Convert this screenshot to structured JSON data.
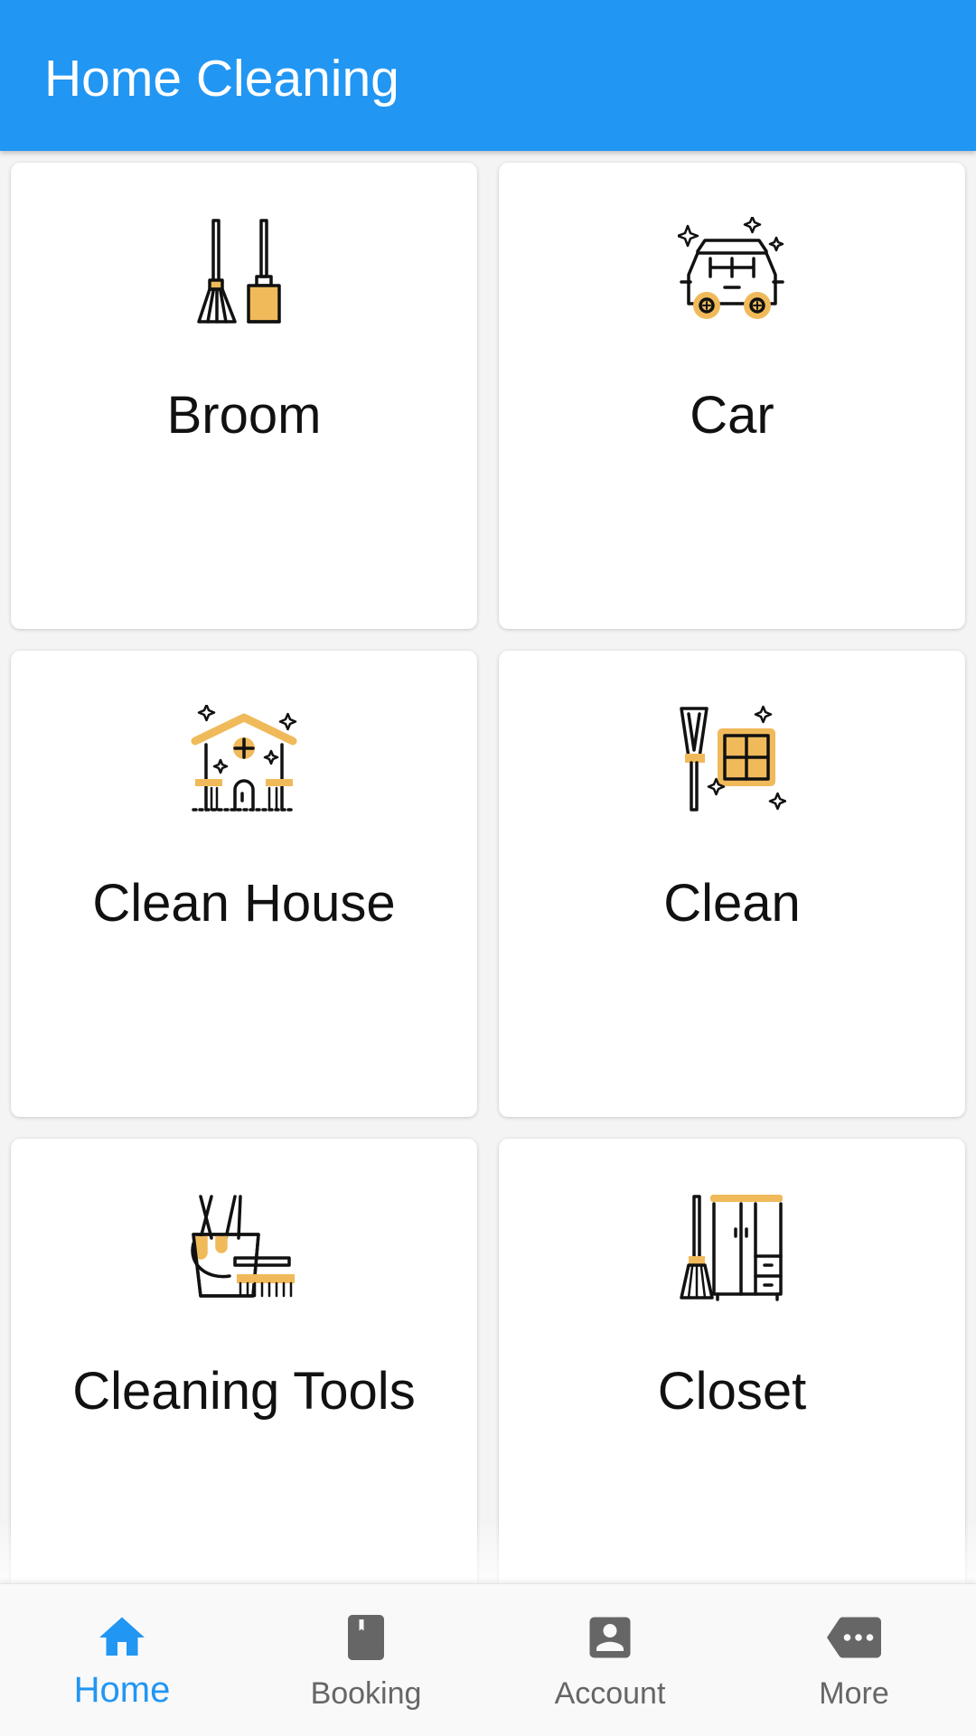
{
  "app_bar": {
    "title": "Home Cleaning"
  },
  "categories": [
    {
      "label": "Broom",
      "icon": "broom-icon"
    },
    {
      "label": "Car",
      "icon": "car-icon"
    },
    {
      "label": "Clean House",
      "icon": "clean-house-icon"
    },
    {
      "label": "Clean",
      "icon": "window-cleaning-icon"
    },
    {
      "label": "Cleaning Tools",
      "icon": "bucket-icon"
    },
    {
      "label": "Closet",
      "icon": "closet-icon"
    }
  ],
  "bottom_nav": {
    "active": "Home",
    "items": [
      {
        "label": "Home",
        "icon": "home-icon"
      },
      {
        "label": "Booking",
        "icon": "bookmark-icon"
      },
      {
        "label": "Account",
        "icon": "account-icon"
      },
      {
        "label": "More",
        "icon": "more-icon"
      }
    ]
  },
  "colors": {
    "primary": "#2196F3",
    "accent": "#F0BA5B",
    "icon_stroke": "#111111",
    "nav_inactive": "#666666"
  }
}
